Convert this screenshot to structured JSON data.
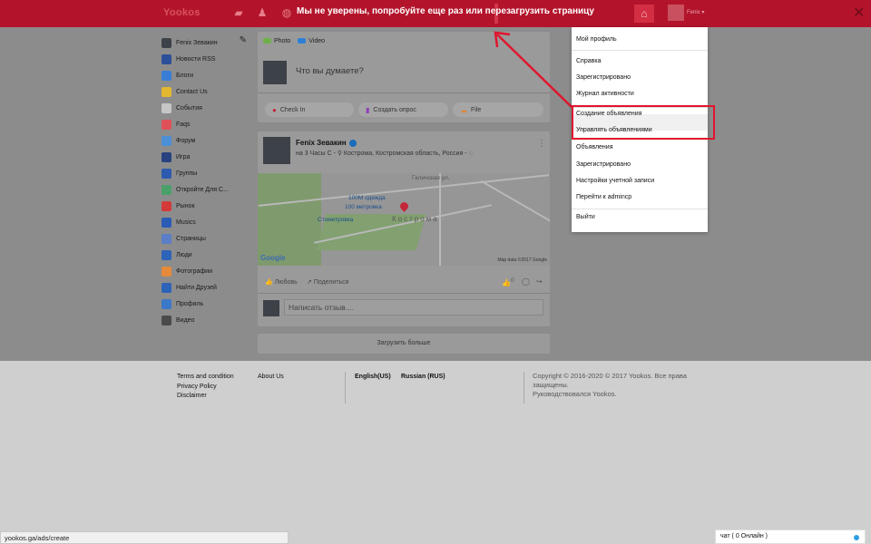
{
  "topbar": {
    "logo": "Yookos",
    "error_message": "Мы не уверены, попробуйте еще раз или перезагрузить страницу",
    "user_name": "Fenix",
    "close_label": "✕"
  },
  "sidebar": {
    "items": [
      {
        "label": "Fenix Зевакин",
        "icon": "avatar",
        "color": "#3d4148"
      },
      {
        "label": "Новости RSS",
        "icon": "news-icon",
        "color": "#2c4f99"
      },
      {
        "label": "Блоги",
        "icon": "blog-icon",
        "color": "#3a7dd6"
      },
      {
        "label": "Contact Us",
        "icon": "contact-icon",
        "color": "#e3b830"
      },
      {
        "label": "События",
        "icon": "calendar-icon",
        "color": "#c6c6c6"
      },
      {
        "label": "Faqs",
        "icon": "faq-icon",
        "color": "#e05058"
      },
      {
        "label": "Форум",
        "icon": "forum-icon",
        "color": "#4b8fd6"
      },
      {
        "label": "Игра",
        "icon": "game-icon",
        "color": "#27427e"
      },
      {
        "label": "Группы",
        "icon": "groups-icon",
        "color": "#2c5bb0"
      },
      {
        "label": "Откройте Для С...",
        "icon": "discover-icon",
        "color": "#4aa06a"
      },
      {
        "label": "Рынок",
        "icon": "market-icon",
        "color": "#d43a3a"
      },
      {
        "label": "Musics",
        "icon": "music-icon",
        "color": "#2a5cb5"
      },
      {
        "label": "Страницы",
        "icon": "pages-icon",
        "color": "#5b7ec6"
      },
      {
        "label": "Люди",
        "icon": "people-icon",
        "color": "#2d63b8"
      },
      {
        "label": "Фотографии",
        "icon": "photos-icon",
        "color": "#e48a3a"
      },
      {
        "label": "Найти Друзей",
        "icon": "find-friends-icon",
        "color": "#2d63b8"
      },
      {
        "label": "Профиль",
        "icon": "profile-icon",
        "color": "#3a78c8"
      },
      {
        "label": "Видео",
        "icon": "video-icon",
        "color": "#4b4b4b"
      }
    ]
  },
  "composer": {
    "tab_photo": "Photo",
    "tab_video": "Video",
    "placeholder": "Что вы думаете?",
    "checkin": "Check In",
    "poll": "Создать опрос",
    "file": "File"
  },
  "post": {
    "author": "Fenix Зевакин",
    "meta": "на 3 Часы С - ⚲ Кострома, Костромская область, Россия - ◌",
    "more": "⋮",
    "map": {
      "city": "Кострома",
      "labels": [
        "100М одежда",
        "100 метровка",
        "Стометровка",
        "Галичская ул."
      ],
      "google": "Google",
      "map_data": "Map data ©2017 Google"
    },
    "like": "Любовь",
    "share": "Поделиться",
    "like_count": "0",
    "comment_placeholder": "Написать отзыв...."
  },
  "load_more": "Загрузить больше",
  "dropdown": {
    "items": [
      "Мой профиль",
      "Справка",
      "Зарегистрировано",
      "Журнал активности",
      "Создание объявления",
      "Управлять объявлениями",
      "Объявления",
      "Зарегистрировано",
      "Настройки учетной записи",
      "Перейти к admincp",
      "Выйти"
    ]
  },
  "footer": {
    "links_col1": [
      "Terms and condition",
      "Privacy Policy",
      "Disclaimer"
    ],
    "about": "About Us",
    "lang_en": "English(US)",
    "lang_ru": "Russian (RUS)",
    "copyright": "Copyright © 2016-2020 © 2017 Yookos. Все права защищены.",
    "powered": "Руководствовался Yookos."
  },
  "status_url": "yookos.ga/ads/create",
  "chat": {
    "label": "чат ( 0 Онлайн )"
  },
  "colors": {
    "topbar": "#b3142b",
    "highlight_box": "#e1152d",
    "dim_bg": "#8c8c8c"
  }
}
